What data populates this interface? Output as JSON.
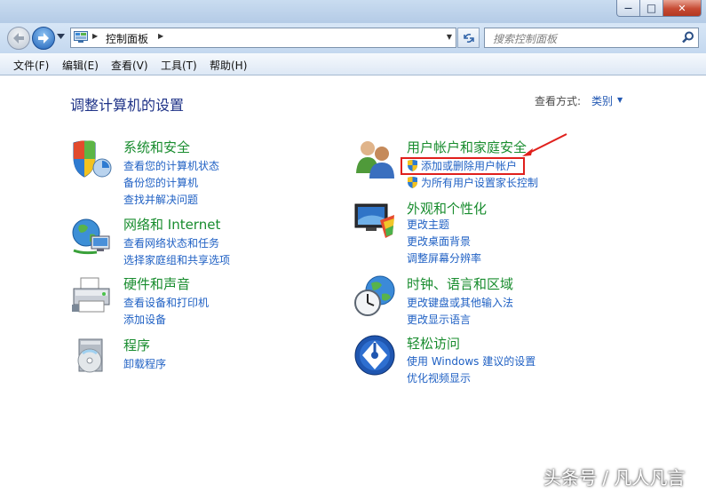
{
  "window": {
    "minimize_glyph": "—",
    "maximize_glyph": "□",
    "close_glyph": "✕"
  },
  "address_bar": {
    "breadcrumb": "控制面板",
    "search_placeholder": "搜索控制面板"
  },
  "menu": [
    "文件(F)",
    "编辑(E)",
    "查看(V)",
    "工具(T)",
    "帮助(H)"
  ],
  "content": {
    "heading": "调整计算机的设置",
    "view_by_label": "查看方式:",
    "view_by_value": "类别"
  },
  "categories_left": [
    {
      "title": "系统和安全",
      "icon": "shield-security-icon",
      "links": [
        "查看您的计算机状态",
        "备份您的计算机",
        "查找并解决问题"
      ]
    },
    {
      "title": "网络和 Internet",
      "icon": "globe-network-icon",
      "links": [
        "查看网络状态和任务",
        "选择家庭组和共享选项"
      ]
    },
    {
      "title": "硬件和声音",
      "icon": "printer-icon",
      "links": [
        "查看设备和打印机",
        "添加设备"
      ]
    },
    {
      "title": "程序",
      "icon": "programs-icon",
      "links": [
        "卸载程序"
      ]
    }
  ],
  "categories_right": [
    {
      "title": "用户帐户和家庭安全",
      "icon": "users-icon",
      "links": [
        "添加或删除用户帐户",
        "为所有用户设置家长控制"
      ]
    },
    {
      "title": "外观和个性化",
      "icon": "appearance-icon",
      "links": [
        "更改主题",
        "更改桌面背景",
        "调整屏幕分辨率"
      ]
    },
    {
      "title": "时钟、语言和区域",
      "icon": "clock-globe-icon",
      "links": [
        "更改键盘或其他输入法",
        "更改显示语言"
      ]
    },
    {
      "title": "轻松访问",
      "icon": "ease-of-access-icon",
      "links": [
        "使用 Windows 建议的设置",
        "优化视频显示"
      ]
    }
  ],
  "watermark": "头条号 / 凡人凡言",
  "colors": {
    "title_green": "#188c2e",
    "link_blue": "#2061c4",
    "heading_blue": "#1e3287",
    "highlight_red": "#e0201c"
  }
}
